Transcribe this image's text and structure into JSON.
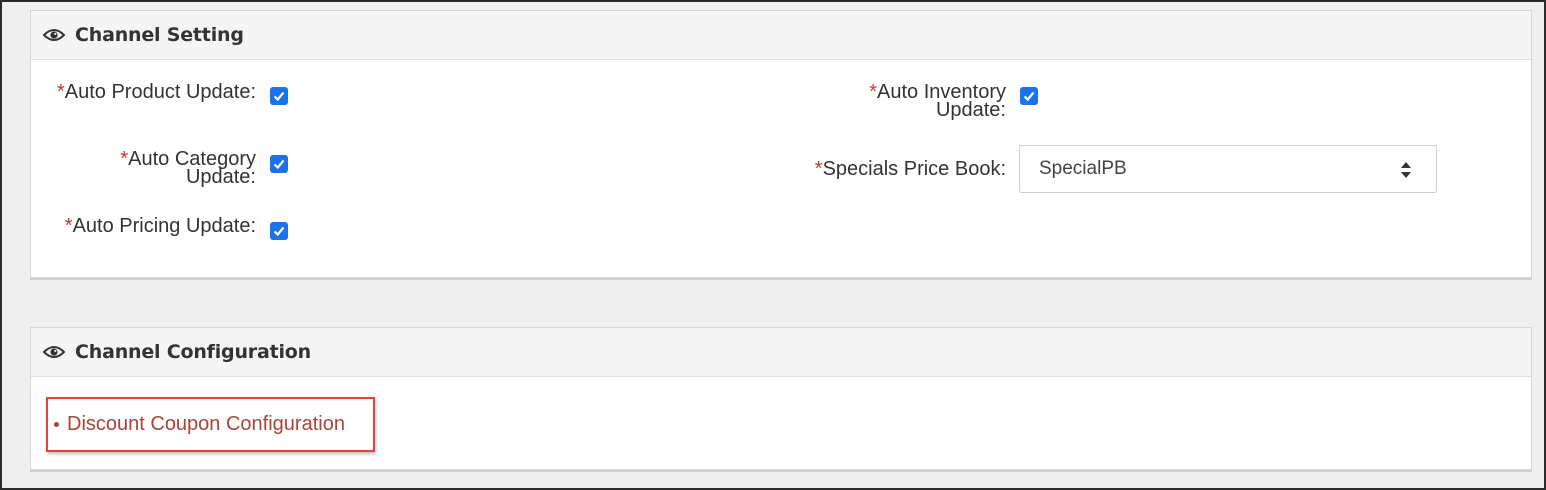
{
  "channel_setting": {
    "title": "Channel Setting",
    "required_mark": "*",
    "auto_product_update": {
      "label": "Auto Product Update:",
      "checked": true
    },
    "auto_category_update": {
      "label_line1": "Auto Category",
      "label_line2": "Update:",
      "checked": true
    },
    "auto_pricing_update": {
      "label": "Auto Pricing Update:",
      "checked": true
    },
    "auto_inventory_update": {
      "label_line1": "Auto Inventory",
      "label_line2": "Update:",
      "checked": true
    },
    "specials_price_book": {
      "label": "Specials Price Book:",
      "value": "SpecialPB"
    }
  },
  "channel_configuration": {
    "title": "Channel Configuration",
    "links": [
      "Discount Coupon Configuration"
    ]
  },
  "colors": {
    "required": "#c0392b",
    "checkbox": "#1a73e8",
    "link": "#a94438",
    "highlight_border": "#e0453a"
  },
  "icons": {
    "panel_header": "eye-icon",
    "select": "up-down-arrows-icon"
  }
}
